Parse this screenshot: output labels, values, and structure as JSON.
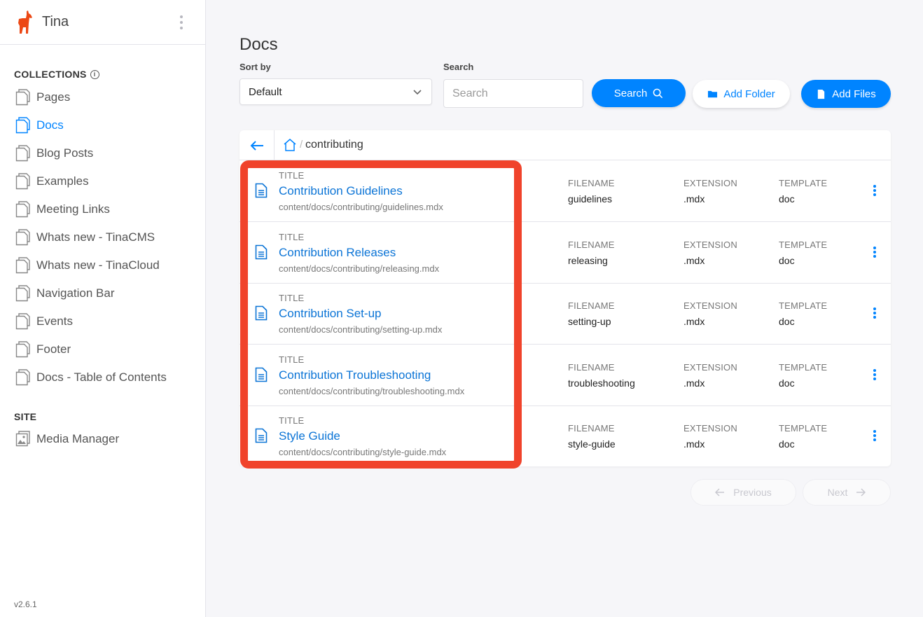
{
  "brand": {
    "name": "Tina",
    "logo_icon": "llama-logo-icon",
    "color": "#ec4815"
  },
  "sidebar": {
    "collections_title": "COLLECTIONS",
    "items": [
      {
        "label": "Pages",
        "icon": "document-icon",
        "active": false
      },
      {
        "label": "Docs",
        "icon": "document-icon",
        "active": true
      },
      {
        "label": "Blog Posts",
        "icon": "document-icon",
        "active": false
      },
      {
        "label": "Examples",
        "icon": "document-icon",
        "active": false
      },
      {
        "label": "Meeting Links",
        "icon": "document-icon",
        "active": false
      },
      {
        "label": "Whats new - TinaCMS",
        "icon": "document-icon",
        "active": false
      },
      {
        "label": "Whats new - TinaCloud",
        "icon": "document-icon",
        "active": false
      },
      {
        "label": "Navigation Bar",
        "icon": "document-icon",
        "active": false
      },
      {
        "label": "Events",
        "icon": "document-icon",
        "active": false
      },
      {
        "label": "Footer",
        "icon": "document-icon",
        "active": false
      },
      {
        "label": "Docs - Table of Contents",
        "icon": "document-icon",
        "active": false
      }
    ],
    "site_title": "SITE",
    "site_items": [
      {
        "label": "Media Manager",
        "icon": "image-icon"
      }
    ],
    "version": "v2.6.1"
  },
  "main": {
    "title": "Docs",
    "sort_label": "Sort by",
    "sort_value": "Default",
    "search_label": "Search",
    "search_placeholder": "Search",
    "search_button": "Search",
    "add_folder_button": "Add Folder",
    "add_files_button": "Add Files",
    "breadcrumb": {
      "separator": "/",
      "current": "contributing"
    },
    "columns": {
      "title": "TITLE",
      "filename": "FILENAME",
      "extension": "EXTENSION",
      "template": "TEMPLATE"
    },
    "rows": [
      {
        "title": "Contribution Guidelines",
        "path": "content/docs/contributing/guidelines.mdx",
        "filename": "guidelines",
        "extension": ".mdx",
        "template": "doc"
      },
      {
        "title": "Contribution Releases",
        "path": "content/docs/contributing/releasing.mdx",
        "filename": "releasing",
        "extension": ".mdx",
        "template": "doc"
      },
      {
        "title": "Contribution Set-up",
        "path": "content/docs/contributing/setting-up.mdx",
        "filename": "setting-up",
        "extension": ".mdx",
        "template": "doc"
      },
      {
        "title": "Contribution Troubleshooting",
        "path": "content/docs/contributing/troubleshooting.mdx",
        "filename": "troubleshooting",
        "extension": ".mdx",
        "template": "doc"
      },
      {
        "title": "Style Guide",
        "path": "content/docs/contributing/style-guide.mdx",
        "filename": "style-guide",
        "extension": ".mdx",
        "template": "doc"
      }
    ],
    "pagination": {
      "previous": "Previous",
      "next": "Next"
    }
  },
  "colors": {
    "accent": "#0084ff",
    "highlight": "#f0432b",
    "link": "#0b74d6"
  }
}
